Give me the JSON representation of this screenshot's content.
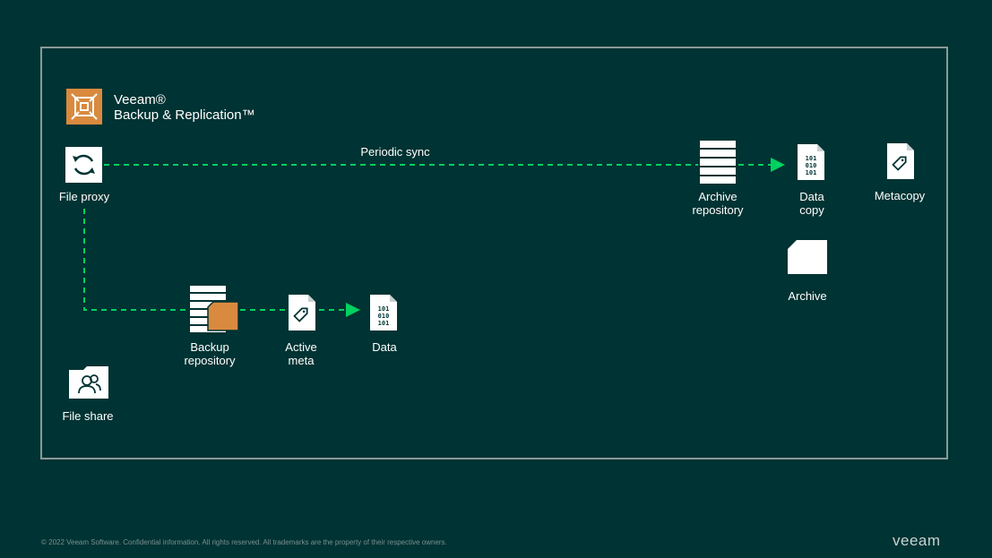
{
  "brand": {
    "line1": "Veeam®",
    "line2": "Backup & Replication™"
  },
  "diagram": {
    "sync_label": "Periodic sync",
    "nodes": {
      "file_proxy": "File proxy",
      "archive_repository": [
        "Archive",
        "repository"
      ],
      "data_copy": [
        "Data",
        "copy"
      ],
      "metacopy": "Metacopy",
      "archive": "Archive",
      "backup_repository": [
        "Backup",
        "repository"
      ],
      "active_meta": [
        "Active",
        "meta"
      ],
      "data": "Data",
      "file_share": "File share"
    },
    "binary_text": [
      "101",
      "010",
      "101"
    ]
  },
  "footer": {
    "copyright": "© 2022 Veeam Software. Confidential information. All rights reserved. All trademarks are the property of their respective owners.",
    "logo": "veeam"
  },
  "colors": {
    "background": "#003333",
    "accent_green": "#00D15F",
    "accent_orange": "#D98A3E",
    "frame_border": "#8A9A9A"
  }
}
